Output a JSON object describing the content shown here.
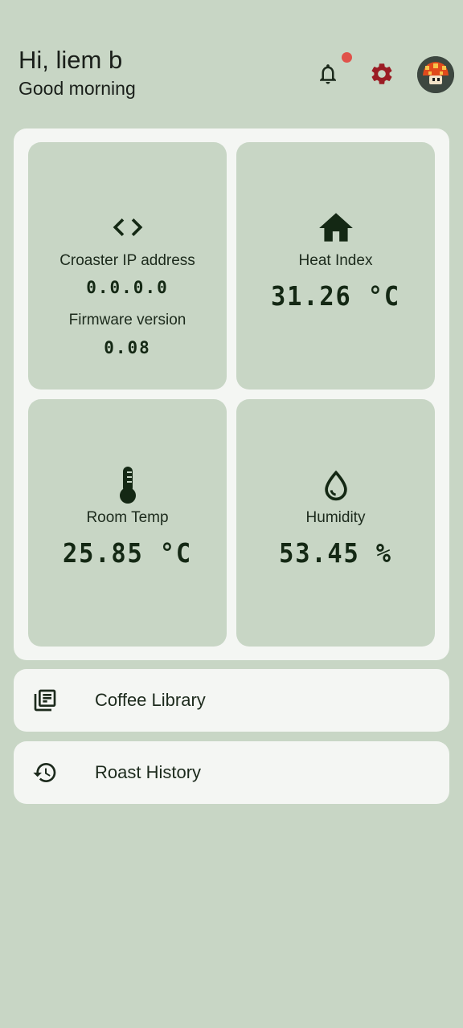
{
  "header": {
    "greeting": "Hi, liem b",
    "subgreeting": "Good morning",
    "notification_icon": "bell-icon",
    "settings_icon": "gear-icon",
    "accent_settings": "#9b1c24",
    "notification_dot_color": "#e0524a",
    "avatar_icon": "mushroom-avatar"
  },
  "tiles": {
    "ip": {
      "icon": "code-icon",
      "label": "Croaster IP address",
      "value": "0.0.0.0",
      "firmware_label": "Firmware version",
      "firmware_value": "0.08"
    },
    "heat_index": {
      "icon": "home-icon",
      "label": "Heat Index",
      "value": "31.26 °C"
    },
    "room_temp": {
      "icon": "thermometer-icon",
      "label": "Room Temp",
      "value": "25.85 °C"
    },
    "humidity": {
      "icon": "water-drop-icon",
      "label": "Humidity",
      "value": "53.45 %"
    }
  },
  "menu": {
    "library": {
      "icon": "library-books-icon",
      "label": "Coffee Library"
    },
    "history": {
      "icon": "history-icon",
      "label": "Roast History"
    }
  },
  "colors": {
    "background": "#c8d6c5",
    "card": "#f4f6f3",
    "dark_green": "#142814"
  }
}
